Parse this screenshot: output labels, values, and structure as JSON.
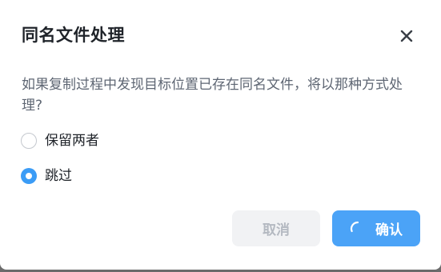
{
  "dialog": {
    "title": "同名文件处理",
    "message": "如果复制过程中发现目标位置已存在同名文件，将以那种方式处理?",
    "close_icon": "close-icon"
  },
  "options": [
    {
      "label": "保留两者",
      "checked": false
    },
    {
      "label": "跳过",
      "checked": true
    }
  ],
  "buttons": {
    "cancel_label": "取消",
    "confirm_label": "确认",
    "confirm_loading": true
  },
  "colors": {
    "accent": "#4ba3f7",
    "radio_checked": "#3b9cf6",
    "title_text": "#1f2329",
    "message_text": "#5e6673",
    "cancel_bg": "#f1f2f4",
    "cancel_text": "#b4b9c1"
  }
}
